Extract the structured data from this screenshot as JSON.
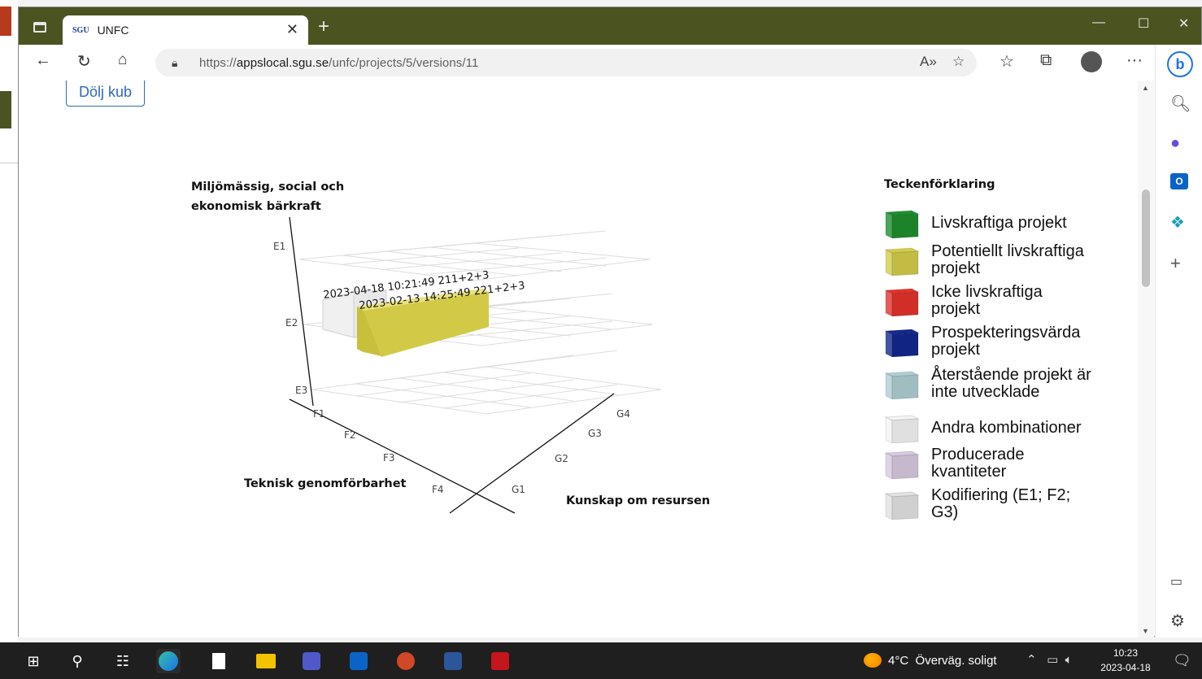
{
  "browser": {
    "tab_title": "UNFC",
    "tab_favicon_text": "SGU",
    "url_scheme": "https://",
    "url_host": "appslocal.sgu.se",
    "url_path": "/unfc/projects/5/versions/11",
    "icons": [
      "window-menu-icon",
      "close-icon",
      "new-tab-icon",
      "back-icon",
      "refresh-icon",
      "home-icon",
      "lock-icon",
      "read-aloud-icon",
      "favorite-add-icon",
      "favorites-icon",
      "collections-icon",
      "profile-icon",
      "more-icon",
      "bing-icon"
    ]
  },
  "page": {
    "hide_button": "Dölj kub",
    "axis_e_title_line1": "Miljömässig, social och",
    "axis_e_title_line2": "ekonomisk bärkraft",
    "axis_f_title": "Teknisk genomförbarhet",
    "axis_g_title": "Kunskap om resursen",
    "e_ticks": [
      "E1",
      "E2",
      "E3"
    ],
    "f_ticks": [
      "F1",
      "F2",
      "F3",
      "F4"
    ],
    "g_ticks": [
      "G1",
      "G2",
      "G3",
      "G4"
    ],
    "box_label_back": "2023-04-18 10:21:49 211+2+3",
    "box_label_front": "2023-02-13 14:25:49 221+2+3"
  },
  "legend": {
    "title": "Teckenförklaring",
    "items": [
      {
        "label": "Livskraftiga projekt",
        "color": "#1f8f2f"
      },
      {
        "label": "Potentiellt livskraftiga projekt",
        "color": "#d4cc4a"
      },
      {
        "label": "Icke livskraftiga projekt",
        "color": "#e2322b"
      },
      {
        "label": "Prospekteringsvärda projekt",
        "color": "#13288f"
      },
      {
        "label": "Återstående projekt är inte utvecklade",
        "color": "#aecfd3"
      },
      {
        "label": "Andra kombinationer",
        "color": "#f4f4f4"
      },
      {
        "label": "Producerade kvantiteter",
        "color": "#d7c9df"
      },
      {
        "label": "Kodifiering (E1; F2; G3)",
        "color": "#e2e2e2"
      }
    ]
  },
  "taskbar": {
    "weather_temp": "4°C",
    "weather_text": "Överväg. soligt",
    "time": "10:23",
    "date": "2023-04-18"
  }
}
